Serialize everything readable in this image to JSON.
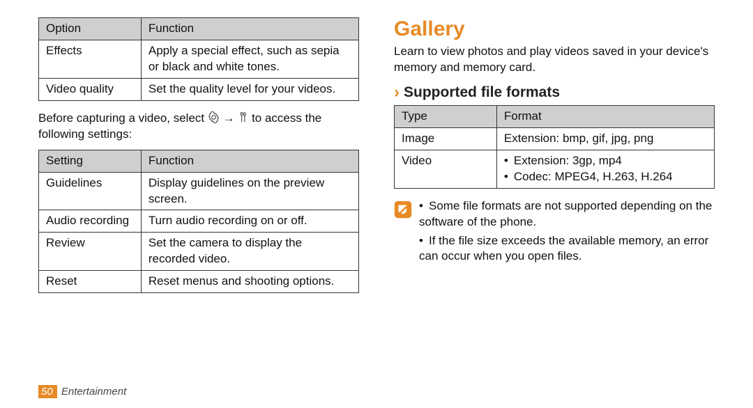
{
  "left": {
    "options_table": {
      "headers": [
        "Option",
        "Function"
      ],
      "rows": [
        [
          "Effects",
          "Apply a special effect, such as sepia or black and white tones."
        ],
        [
          "Video quality",
          "Set the quality level for your videos."
        ]
      ]
    },
    "paragraph_before": "Before capturing a video, select ",
    "paragraph_after": " to access the following settings:",
    "arrow": "→",
    "settings_table": {
      "headers": [
        "Setting",
        "Function"
      ],
      "rows": [
        [
          "Guidelines",
          "Display guidelines on the preview screen."
        ],
        [
          "Audio recording",
          "Turn audio recording on or off."
        ],
        [
          "Review",
          "Set the camera to display the recorded video."
        ],
        [
          "Reset",
          "Reset menus and shooting options."
        ]
      ]
    }
  },
  "right": {
    "title": "Gallery",
    "intro": "Learn to view photos and play videos saved in your device's memory and memory card.",
    "subtitle": "Supported file formats",
    "formats_table": {
      "headers": [
        "Type",
        "Format"
      ],
      "rows": [
        {
          "type": "Image",
          "format_text": "Extension: bmp, gif, jpg, png"
        },
        {
          "type": "Video",
          "format_list": [
            "Extension: 3gp, mp4",
            "Codec: MPEG4, H.263, H.264"
          ]
        }
      ]
    },
    "notes": [
      "Some file formats are not supported depending on the software of the phone.",
      "If the file size exceeds the available memory, an error can occur when you open files."
    ]
  },
  "footer": {
    "page": "50",
    "chapter": "Entertainment"
  }
}
